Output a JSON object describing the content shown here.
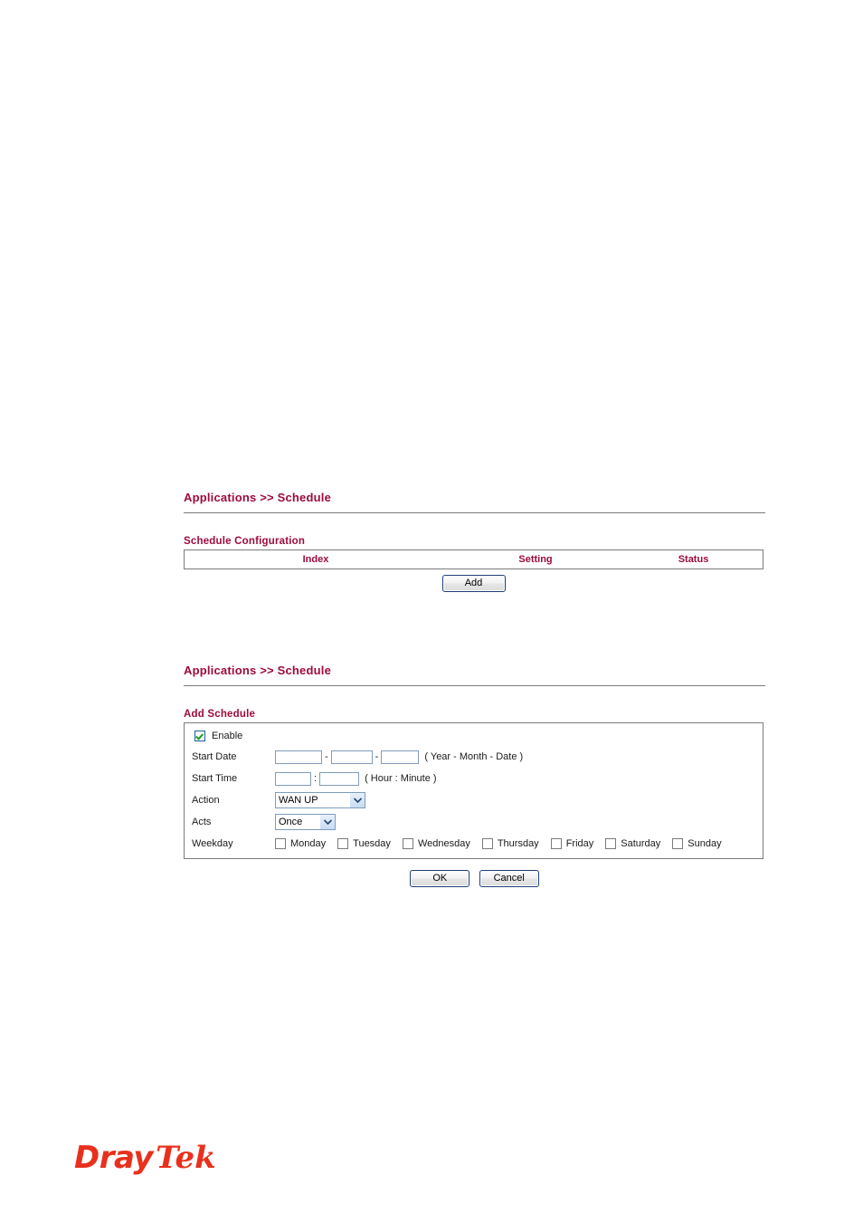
{
  "section_one": {
    "page_title": "Applications >> Schedule",
    "block_title": "Schedule Configuration",
    "table": {
      "columns": [
        "Index",
        "Setting",
        "Status"
      ],
      "rows": []
    },
    "add_button": "Add"
  },
  "section_two": {
    "page_title": "Applications >> Schedule",
    "block_title": "Add Schedule",
    "enable": {
      "label": "Enable",
      "checked": true
    },
    "start_date": {
      "label": "Start Date",
      "year": "",
      "month": "",
      "date": "",
      "separator": "-",
      "hint": "( Year - Month - Date )"
    },
    "start_time": {
      "label": "Start Time",
      "hour": "",
      "minute": "",
      "separator": ":",
      "hint": "( Hour : Minute )"
    },
    "action": {
      "label": "Action",
      "value": "WAN UP"
    },
    "acts": {
      "label": "Acts",
      "value": "Once"
    },
    "weekday": {
      "label": "Weekday",
      "days": [
        {
          "name": "Monday",
          "checked": false
        },
        {
          "name": "Tuesday",
          "checked": false
        },
        {
          "name": "Wednesday",
          "checked": false
        },
        {
          "name": "Thursday",
          "checked": false
        },
        {
          "name": "Friday",
          "checked": false
        },
        {
          "name": "Saturday",
          "checked": false
        },
        {
          "name": "Sunday",
          "checked": false
        }
      ]
    },
    "ok_button": "OK",
    "cancel_button": "Cancel"
  },
  "footer": {
    "logo_part1": "Dray",
    "logo_part2": "Tek"
  },
  "colors": {
    "heading": "#9e0b3b",
    "logo": "#e8301c",
    "rule": "#7b7b7b",
    "input_border": "#7f9db9",
    "button_border": "#1f3f77"
  }
}
